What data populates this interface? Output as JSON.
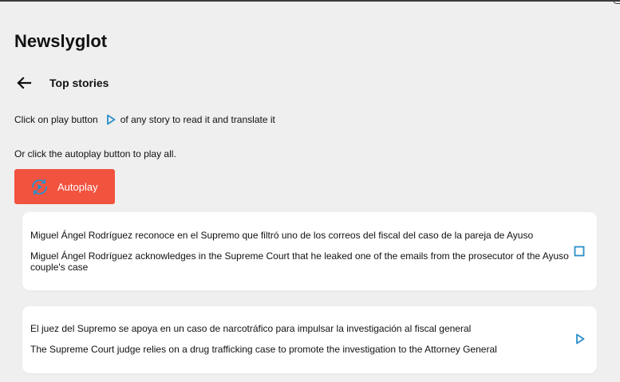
{
  "app": {
    "title": "Newslyglot"
  },
  "header": {
    "back_icon": "arrow-left-icon",
    "section_title": "Top stories"
  },
  "instructions": {
    "line1_before": "Click on play button",
    "line1_icon": "play-icon",
    "line1_after": "of any story to read it and translate it",
    "line2": "Or click the autoplay button to play all."
  },
  "autoplay": {
    "label": "Autoplay",
    "icon": "autoplay-cycle-icon"
  },
  "stories": [
    {
      "original": "Miguel Ángel Rodríguez reconoce en el Supremo que filtró uno de los correos del fiscal del caso de la pareja de Ayuso",
      "translation": "Miguel Ángel Rodríguez acknowledges in the Supreme Court that he leaked one of the emails from the prosecutor of the Ayuso couple's case",
      "action_icon": "stop-icon"
    },
    {
      "original": "El juez del Supremo se apoya en un caso de narcotráfico para impulsar la investigación al fiscal general",
      "translation": "The Supreme Court judge relies on a drug trafficking case to promote the investigation to the Attorney General",
      "action_icon": "play-icon"
    }
  ],
  "colors": {
    "background": "#efefef",
    "accent": "#f2533f",
    "icon_blue": "#2a8fc9",
    "card": "#ffffff"
  }
}
